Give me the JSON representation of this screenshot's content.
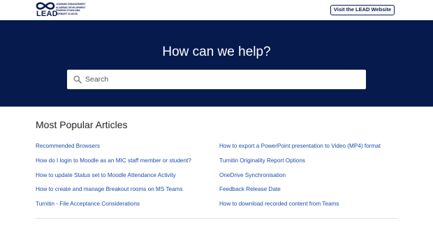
{
  "header": {
    "logo_text": "LEAD",
    "logo_tagline_lines": [
      "LEARNING ENHANCEMENT",
      "ACADEMIC DEVELOPMENT",
      "FEABHSÚ FOGHLAMA",
      "FORBAIRT ACADÚIL"
    ],
    "visit_button_label": "Visit the LEAD Website"
  },
  "hero": {
    "title": "How can we help?",
    "search_placeholder": "Search"
  },
  "articles_section": {
    "title": "Most Popular Articles",
    "left_column": [
      "Recommended Browsers",
      "How do I login to Moodle as an MIC staff member or student?",
      "How to update Status set to Moodle Attendance Activity",
      "How to create and manage Breakout rooms on MS Teams",
      "Turnitin - File Acceptance Considerations"
    ],
    "right_column": [
      "How to export a PowerPoint presentation to Video (MP4) format",
      "Turnitin Originality Report Options",
      "OneDrive Synchronisation",
      "Feedback Release Date",
      "How to download recorded content from Teams"
    ]
  },
  "colors": {
    "brand_navy": "#061a4e",
    "link_blue": "#1a4fa8"
  }
}
